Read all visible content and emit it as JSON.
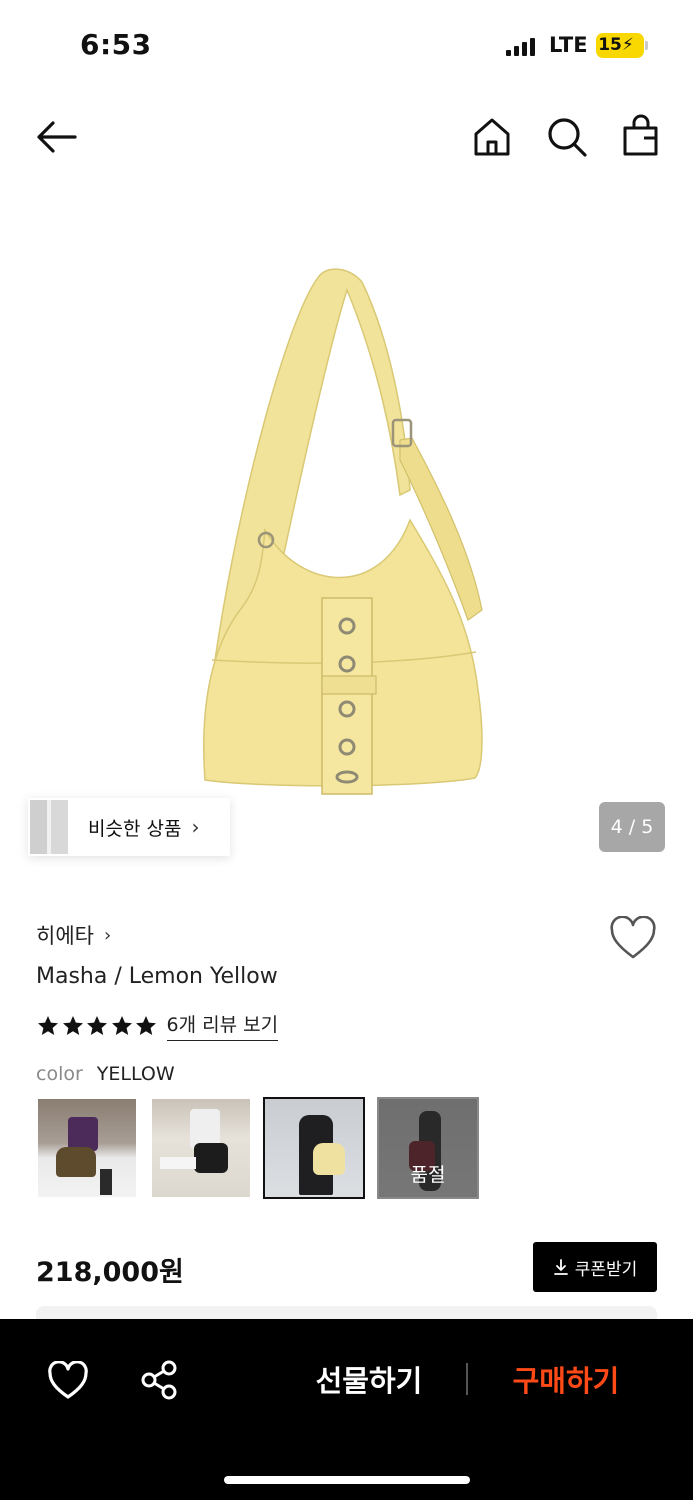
{
  "status_bar": {
    "time": "6:53",
    "network": "LTE",
    "battery": "15"
  },
  "nav": {
    "back_icon": "back-arrow-icon",
    "home_icon": "home-icon",
    "search_icon": "search-icon",
    "bag_icon": "shopping-bag-icon"
  },
  "hero": {
    "similar_label": "비슷한 상품",
    "pager": "4 / 5"
  },
  "product": {
    "brand": "히에타",
    "name": "Masha / Lemon Yellow",
    "rating_stars": 5,
    "review_link": "6개 리뷰 보기",
    "color_key": "color",
    "color_value": "YELLOW",
    "price": "218,000원",
    "coupon_label": "쿠폰받기",
    "swatches": [
      {
        "name": "swatch-brown"
      },
      {
        "name": "swatch-black"
      },
      {
        "name": "swatch-yellow",
        "selected": true
      },
      {
        "name": "swatch-red",
        "soldout_label": "품절"
      }
    ]
  },
  "bottom_bar": {
    "gift_label": "선물하기",
    "buy_label": "구매하기"
  },
  "colors": {
    "accent_buy": "#ff4a17",
    "bag_yellow": "#f4e49a",
    "battery": "#f8d800"
  }
}
